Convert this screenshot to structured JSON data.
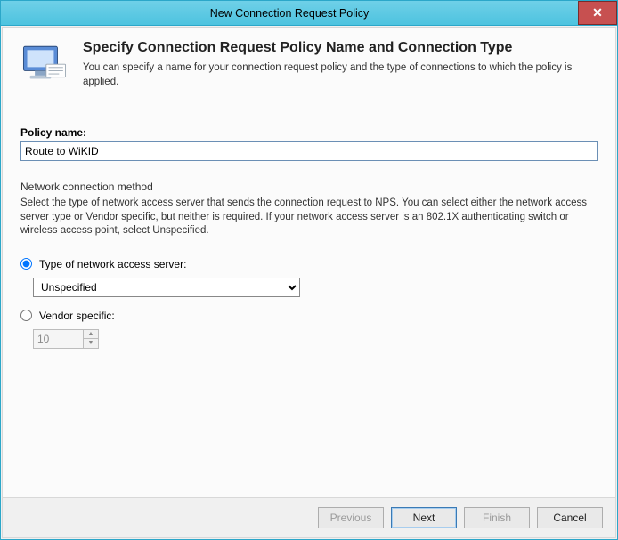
{
  "window": {
    "title": "New Connection Request Policy"
  },
  "header": {
    "heading": "Specify Connection Request Policy Name and Connection Type",
    "description": "You can specify a name for your connection request policy and the type of connections to which the policy is applied."
  },
  "policy": {
    "name_label": "Policy name:",
    "name_value": "Route to WiKID"
  },
  "network": {
    "group_title": "Network connection method",
    "group_desc": "Select the type of network access server that sends the connection request to NPS. You can select either the network access server type or Vendor specific, but neither is required.  If your network access server is an 802.1X authenticating switch or wireless access point, select Unspecified.",
    "type_label": "Type of network access server:",
    "type_selected": "Unspecified",
    "vendor_label": "Vendor specific:",
    "vendor_value": "10",
    "selected_radio": "type"
  },
  "buttons": {
    "previous": "Previous",
    "next": "Next",
    "finish": "Finish",
    "cancel": "Cancel"
  }
}
